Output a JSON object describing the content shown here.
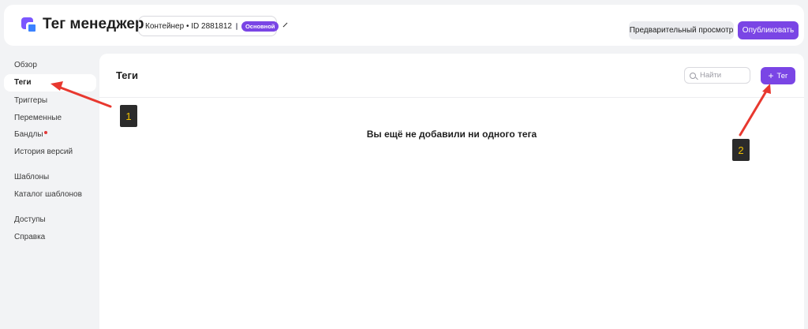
{
  "header": {
    "app_title": "Тег менеджер",
    "container_label": "Контейнер • ID 2881812",
    "container_badge": "Основной",
    "preview_label": "Предварительный просмотр",
    "publish_label": "Опубликовать"
  },
  "sidebar": {
    "items": [
      {
        "label": "Обзор"
      },
      {
        "label": "Теги"
      },
      {
        "label": "Триггеры"
      },
      {
        "label": "Переменные"
      },
      {
        "label": "Бандлы"
      },
      {
        "label": "История версий"
      },
      {
        "label": "Шаблоны"
      },
      {
        "label": "Каталог шаблонов"
      },
      {
        "label": "Доступы"
      },
      {
        "label": "Справка"
      }
    ],
    "active_item": "Теги"
  },
  "main": {
    "title": "Теги",
    "search_placeholder": "Найти",
    "add_label": "Тег",
    "empty_message": "Вы ещё не добавили ни одного тега"
  },
  "annotations": {
    "marker_1": "1",
    "marker_2": "2",
    "arrow_color": "#e8382f"
  },
  "colors": {
    "accent": "#7a45e5",
    "background": "#f2f3f5"
  }
}
